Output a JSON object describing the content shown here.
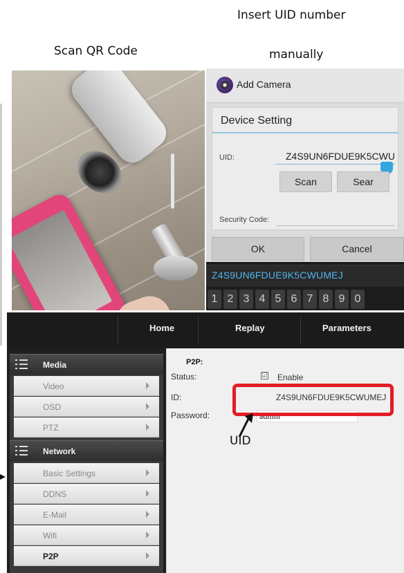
{
  "captions": {
    "scan_qr": "Scan QR Code",
    "insert_line1": "Insert UID number",
    "insert_line2": "manually",
    "uid_note": "UID"
  },
  "android": {
    "title": "Add Camera",
    "section_title": "Device Setting",
    "uid_label": "UID:",
    "uid_value": "Z4S9UN6FDUE9K5CWU",
    "scan_button": "Scan",
    "search_button": "Sear",
    "security_label": "Security Code:",
    "ok_button": "OK",
    "cancel_button": "Cancel",
    "suggestion": "Z4S9UN6FDUE9K5CWUMEJ",
    "keys": [
      "1",
      "2",
      "3",
      "4",
      "5",
      "6",
      "7",
      "8",
      "9",
      "0"
    ]
  },
  "web": {
    "nav": {
      "home": "Home",
      "replay": "Replay",
      "parameters": "Parameters"
    },
    "sidebar": {
      "media_group": "Media",
      "media_items": [
        "Video",
        "OSD",
        "PTZ"
      ],
      "network_group": "Network",
      "network_items": [
        "Basic Settings",
        "DDNS",
        "E-Mail",
        "Wifi",
        "P2P"
      ]
    },
    "p2p": {
      "heading": "P2P:",
      "status_label": "Status:",
      "enable_label": "Enable",
      "enable_checked": true,
      "check_mark": "☑",
      "id_label": "ID:",
      "id_value": "Z4S9UN6FDUE9K5CWUMEJ",
      "password_label": "Password:",
      "password_value": "admin"
    }
  },
  "colors": {
    "highlight_red": "#e31c25",
    "android_accent": "#33a6e0",
    "suggestion_text": "#4fb6ee"
  }
}
